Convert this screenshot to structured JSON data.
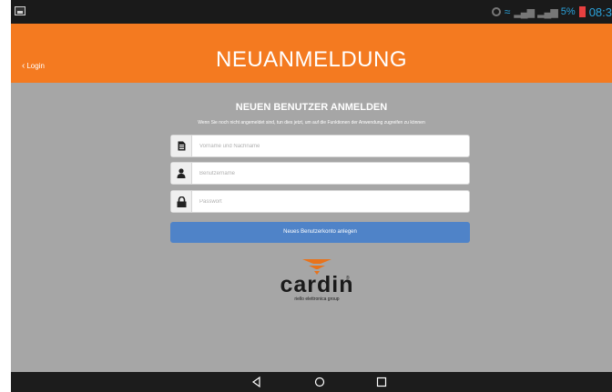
{
  "status_bar": {
    "battery": "5%",
    "time": "08:3"
  },
  "header": {
    "back_label": "Login",
    "title": "NEUANMELDUNG"
  },
  "form": {
    "heading": "NEUEN BENUTZER ANMELDEN",
    "description": "Wenn Sie noch nicht angemeldet sind, tun dies jetzt, um auf die Funktionen der Anwendung zugreifen zu können",
    "fields": [
      {
        "icon": "document-icon",
        "placeholder": "Vorname und Nachname",
        "value": ""
      },
      {
        "icon": "user-icon",
        "placeholder": "Benutzername",
        "value": ""
      },
      {
        "icon": "lock-icon",
        "placeholder": "Passwort",
        "value": ""
      }
    ],
    "submit_label": "Neues Benutzerkonto anlegen"
  },
  "logo": {
    "name": "cardin",
    "tagline": "riello elettronica group"
  },
  "colors": {
    "accent": "#f47a20",
    "button": "#4f83c8",
    "background": "#a6a6a6",
    "status_accent": "#2ba3dc"
  },
  "nav_icons": [
    "back-icon",
    "home-icon",
    "recents-icon"
  ]
}
